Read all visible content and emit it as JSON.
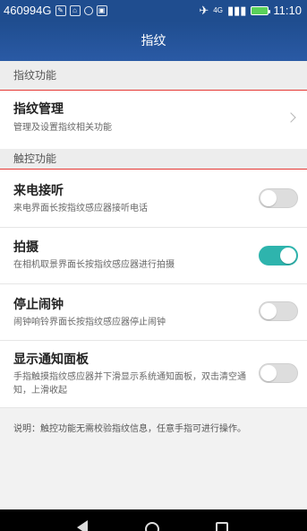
{
  "status_bar": {
    "carrier": "460994G",
    "network": "4G",
    "time": "11:10",
    "icons": [
      "edit-icon",
      "car-icon",
      "wifi-icon",
      "image-icon",
      "alarm-icon",
      "signal-icon",
      "battery-icon"
    ]
  },
  "app_bar": {
    "title": "指纹"
  },
  "sections": {
    "fingerprint": {
      "title": "指纹功能"
    },
    "touch": {
      "title": "触控功能"
    }
  },
  "fingerprint_management": {
    "title": "指纹管理",
    "subtitle": "管理及设置指纹相关功能"
  },
  "touch_items": [
    {
      "title": "来电接听",
      "subtitle": "来电界面长按指纹感应器接听电话",
      "enabled": false
    },
    {
      "title": "拍摄",
      "subtitle": "在相机取景界面长按指纹感应器进行拍摄",
      "enabled": true
    },
    {
      "title": "停止闹钟",
      "subtitle": "闹钟响铃界面长按指纹感应器停止闹钟",
      "enabled": false
    },
    {
      "title": "显示通知面板",
      "subtitle": "手指触摸指纹感应器并下滑显示系统通知面板，双击清空通知，上滑收起",
      "enabled": false
    }
  ],
  "note": "说明：触控功能无需校验指纹信息，任意手指可进行操作。",
  "colors": {
    "app_bar": "#1f4d8f",
    "toggle_on": "#2eb4ad",
    "highlight_line": "#e53935"
  }
}
